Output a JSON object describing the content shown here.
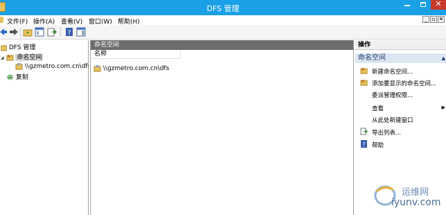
{
  "window": {
    "title": "DFS 管理"
  },
  "menu": {
    "items": [
      "文件(F)",
      "操作(A)",
      "查看(V)",
      "窗口(W)",
      "帮助(H)"
    ],
    "mdi_controls": [
      "_",
      "▫",
      "✕"
    ]
  },
  "tree": {
    "root": "DFS 管理",
    "namespaces": "命名空间",
    "namespace_item": "\\\\gzmetro.com.cn\\dfs",
    "replication": "复制"
  },
  "center": {
    "header": "命名空间",
    "column_name": "名称",
    "rows": [
      "\\\\gzmetro.com.cn\\dfs"
    ]
  },
  "actions": {
    "header": "操作",
    "section": "命名空间",
    "items": [
      {
        "label": "新建命名空间...",
        "icon": "new-namespace-icon"
      },
      {
        "label": "添加要显示的命名空间...",
        "icon": "add-namespace-icon"
      },
      {
        "label": "委派管理权限...",
        "icon": ""
      },
      {
        "label": "查看",
        "icon": ""
      },
      {
        "label": "从此处新建窗口",
        "icon": ""
      },
      {
        "label": "导出列表...",
        "icon": "export-icon"
      },
      {
        "label": "帮助",
        "icon": "help-icon"
      }
    ]
  },
  "watermark": {
    "line1": "运维网",
    "line2": "iyunv.com"
  },
  "colors": {
    "titlebar": "#19a0e6",
    "close": "#c8392b",
    "pane_header": "#6d6d6d",
    "section": "#dbe6f2"
  }
}
